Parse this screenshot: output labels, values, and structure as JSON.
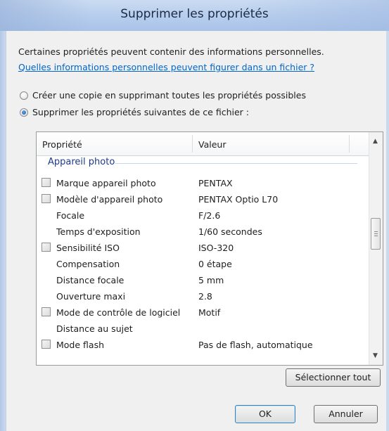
{
  "dialog": {
    "title": "Supprimer les propriétés",
    "info_text": "Certaines propriétés peuvent contenir des informations personnelles.",
    "info_link": "Quelles informations personnelles peuvent figurer dans un fichier ?",
    "option_copy": "Créer une copie en supprimant toutes les propriétés possibles",
    "option_remove": "Supprimer les propriétés suivantes de ce fichier :",
    "selected_option": "option_remove"
  },
  "list": {
    "col_property": "Propriété",
    "col_value": "Valeur",
    "group": "Appareil photo",
    "rows": [
      {
        "name": "Marque appareil photo",
        "value": "PENTAX",
        "checkbox": true
      },
      {
        "name": "Modèle d'appareil photo",
        "value": "PENTAX Optio L70",
        "checkbox": true
      },
      {
        "name": "Focale",
        "value": "F/2.6",
        "checkbox": false
      },
      {
        "name": "Temps d'exposition",
        "value": "1/60 secondes",
        "checkbox": false
      },
      {
        "name": "Sensibilité ISO",
        "value": "ISO-320",
        "checkbox": true
      },
      {
        "name": "Compensation",
        "value": "0 étape",
        "checkbox": false
      },
      {
        "name": "Distance focale",
        "value": "5 mm",
        "checkbox": false
      },
      {
        "name": "Ouverture maxi",
        "value": "2.8",
        "checkbox": false
      },
      {
        "name": "Mode de contrôle de logiciel",
        "value": "Motif",
        "checkbox": true
      },
      {
        "name": "Distance au sujet",
        "value": "",
        "checkbox": false
      },
      {
        "name": "Mode flash",
        "value": "Pas de flash, automatique",
        "checkbox": true
      }
    ]
  },
  "buttons": {
    "select_all": "Sélectionner tout",
    "ok": "OK",
    "cancel": "Annuler"
  },
  "colors": {
    "titlebar": "#b9cfee",
    "link": "#0066cc",
    "group_header": "#1d3a8a"
  }
}
